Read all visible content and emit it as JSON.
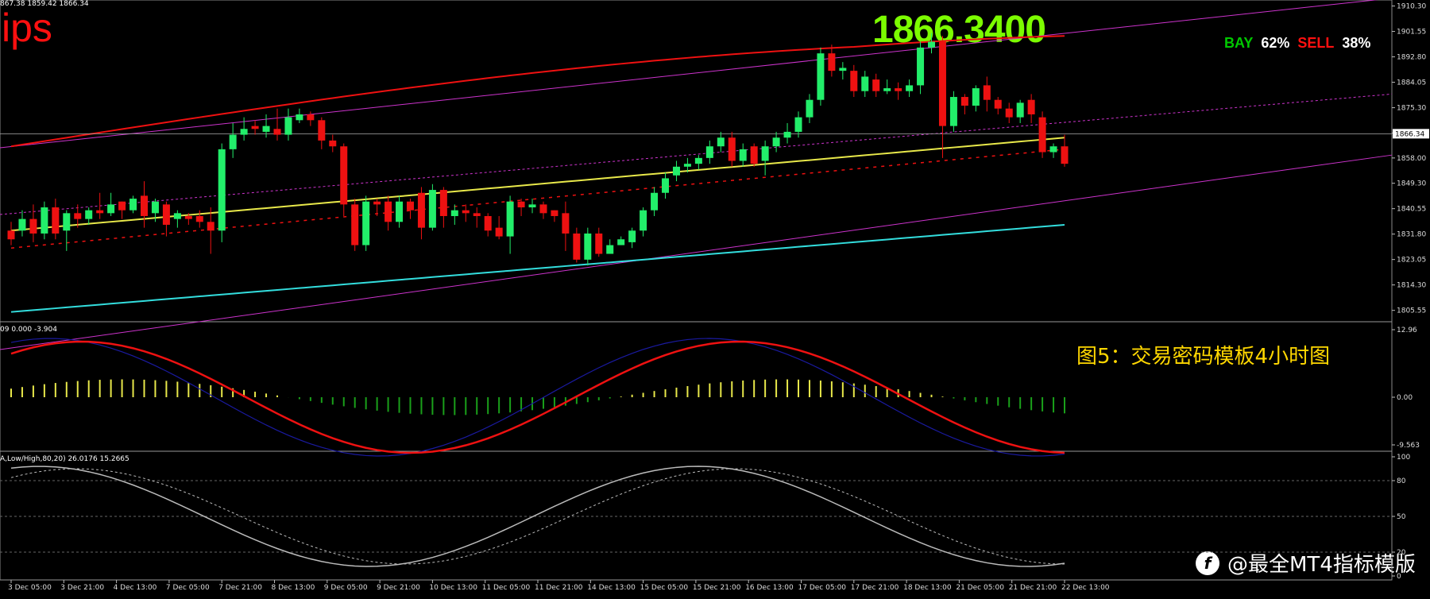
{
  "top_info": "867.38 1859.42 1866.34",
  "brand": "ips",
  "big_price": "1866.3400",
  "sentiment": {
    "buy_label": "BAY",
    "buy_pct": "62%",
    "sell_label": "SELL",
    "sell_pct": "38%"
  },
  "caption": "图5：交易密码模板4小时图",
  "macd_info": "09 0.000 -3.904",
  "stoch_info": "A,Low/High,80,20) 26.0176 15.2665",
  "watermark": "@最全MT4指标模版",
  "current_price_label": "1866.34",
  "colors": {
    "up": "#22ee6a",
    "down": "#ee1111",
    "ma_yellow": "#e8e84a",
    "ma_cyan": "#33dddd",
    "channel": "#cc33cc",
    "ma_red": "#ee1111",
    "macd_signal": "#ee1111",
    "macd_main": "#1a1aa0"
  },
  "chart_data": [
    {
      "type": "candlestick",
      "name": "price",
      "x_labels": [
        "3 Dec 05:00",
        "3 Dec 21:00",
        "4 Dec 13:00",
        "7 Dec 05:00",
        "7 Dec 21:00",
        "8 Dec 13:00",
        "9 Dec 05:00",
        "9 Dec 21:00",
        "10 Dec 13:00",
        "11 Dec 05:00",
        "11 Dec 21:00",
        "14 Dec 13:00",
        "15 Dec 05:00",
        "15 Dec 21:00",
        "16 Dec 13:00",
        "17 Dec 05:00",
        "17 Dec 21:00",
        "18 Dec 13:00",
        "21 Dec 05:00",
        "21 Dec 21:00",
        "22 Dec 13:00"
      ],
      "y_ticks": [
        1910.3,
        1901.55,
        1892.8,
        1884.05,
        1875.3,
        1866.55,
        1858.0,
        1849.3,
        1840.55,
        1831.8,
        1823.05,
        1814.3,
        1805.55
      ],
      "current_price": 1866.34,
      "candles": [
        [
          1833,
          1830,
          1836,
          1828
        ],
        [
          1833,
          1837,
          1840,
          1831
        ],
        [
          1837,
          1832,
          1842,
          1829
        ],
        [
          1832,
          1841,
          1843,
          1830
        ],
        [
          1841,
          1832,
          1844,
          1830
        ],
        [
          1833,
          1839,
          1840,
          1826
        ],
        [
          1839,
          1837,
          1842,
          1834
        ],
        [
          1837,
          1840,
          1841,
          1835
        ],
        [
          1840,
          1839,
          1846,
          1837
        ],
        [
          1839,
          1842,
          1846,
          1838
        ],
        [
          1843,
          1840,
          1843,
          1837
        ],
        [
          1840,
          1844,
          1845,
          1839
        ],
        [
          1845,
          1838,
          1850,
          1834
        ],
        [
          1839,
          1843,
          1844,
          1836
        ],
        [
          1842,
          1835,
          1843,
          1831
        ],
        [
          1837,
          1839,
          1840,
          1834
        ],
        [
          1838,
          1837,
          1839,
          1835
        ],
        [
          1838,
          1836,
          1840,
          1834
        ],
        [
          1836,
          1833,
          1841,
          1825
        ],
        [
          1833,
          1861,
          1863,
          1829
        ],
        [
          1861,
          1866,
          1870,
          1858
        ],
        [
          1866,
          1868,
          1872,
          1864
        ],
        [
          1869,
          1868,
          1871,
          1866
        ],
        [
          1867,
          1869,
          1873,
          1865
        ],
        [
          1868,
          1866,
          1875,
          1864
        ],
        [
          1866,
          1872,
          1875,
          1864
        ],
        [
          1871,
          1873,
          1875,
          1870
        ],
        [
          1873,
          1871,
          1874,
          1869
        ],
        [
          1871,
          1864,
          1872,
          1861
        ],
        [
          1864,
          1862,
          1866,
          1860
        ],
        [
          1862,
          1842,
          1863,
          1838
        ],
        [
          1842,
          1828,
          1844,
          1826
        ],
        [
          1828,
          1843,
          1845,
          1826
        ],
        [
          1843,
          1842,
          1844,
          1838
        ],
        [
          1843,
          1836,
          1845,
          1833
        ],
        [
          1836,
          1843,
          1845,
          1834
        ],
        [
          1843,
          1840,
          1844,
          1837
        ],
        [
          1846,
          1834,
          1848,
          1830
        ],
        [
          1834,
          1847,
          1849,
          1833
        ],
        [
          1847,
          1838,
          1848,
          1834
        ],
        [
          1838,
          1840,
          1842,
          1835
        ],
        [
          1840,
          1839,
          1842,
          1836
        ],
        [
          1839,
          1838,
          1841,
          1834
        ],
        [
          1838,
          1833,
          1839,
          1831
        ],
        [
          1834,
          1831,
          1838,
          1830
        ],
        [
          1831,
          1843,
          1845,
          1825
        ],
        [
          1843,
          1841,
          1844,
          1838
        ],
        [
          1841,
          1842,
          1844,
          1839
        ],
        [
          1842,
          1839,
          1843,
          1837
        ],
        [
          1840,
          1838,
          1840,
          1836
        ],
        [
          1839,
          1832,
          1843,
          1826
        ],
        [
          1832,
          1823,
          1834,
          1822
        ],
        [
          1823,
          1832,
          1834,
          1821
        ],
        [
          1832,
          1825,
          1834,
          1824
        ],
        [
          1825,
          1828,
          1830,
          1826
        ],
        [
          1828,
          1830,
          1831,
          1828
        ],
        [
          1829,
          1833,
          1834,
          1827
        ],
        [
          1833,
          1840,
          1841,
          1831
        ],
        [
          1840,
          1846,
          1848,
          1838
        ],
        [
          1846,
          1851,
          1853,
          1844
        ],
        [
          1852,
          1855,
          1857,
          1850
        ],
        [
          1855,
          1856,
          1858,
          1853
        ],
        [
          1856,
          1858,
          1859,
          1854
        ],
        [
          1858,
          1862,
          1864,
          1856
        ],
        [
          1862,
          1865,
          1867,
          1860
        ],
        [
          1865,
          1857,
          1867,
          1855
        ],
        [
          1857,
          1861,
          1863,
          1855
        ],
        [
          1862,
          1856,
          1863,
          1855
        ],
        [
          1857,
          1862,
          1864,
          1852
        ],
        [
          1862,
          1865,
          1867,
          1860
        ],
        [
          1865,
          1867,
          1870,
          1863
        ],
        [
          1867,
          1872,
          1874,
          1865
        ],
        [
          1872,
          1878,
          1880,
          1870
        ],
        [
          1878,
          1894,
          1896,
          1876
        ],
        [
          1894,
          1888,
          1897,
          1886
        ],
        [
          1888,
          1889,
          1891,
          1885
        ],
        [
          1888,
          1881,
          1890,
          1879
        ],
        [
          1881,
          1886,
          1888,
          1879
        ],
        [
          1885,
          1881,
          1887,
          1879
        ],
        [
          1881,
          1882,
          1885,
          1880
        ],
        [
          1882,
          1881,
          1884,
          1878
        ],
        [
          1881,
          1883,
          1885,
          1879
        ],
        [
          1883,
          1896,
          1898,
          1880
        ],
        [
          1896,
          1898,
          1901,
          1894
        ],
        [
          1898,
          1869,
          1900,
          1858
        ],
        [
          1869,
          1879,
          1881,
          1867
        ],
        [
          1879,
          1876,
          1880,
          1873
        ],
        [
          1876,
          1882,
          1883,
          1874
        ],
        [
          1883,
          1878,
          1886,
          1874
        ],
        [
          1878,
          1875,
          1879,
          1873
        ],
        [
          1875,
          1872,
          1877,
          1870
        ],
        [
          1872,
          1877,
          1878,
          1870
        ],
        [
          1878,
          1873,
          1880,
          1870
        ],
        [
          1872,
          1860,
          1874,
          1858
        ],
        [
          1860,
          1862,
          1863,
          1858
        ],
        [
          1862,
          1856,
          1866,
          1855
        ]
      ]
    },
    {
      "type": "line",
      "name": "macd",
      "y_ticks": [
        "12.96",
        "0.00",
        "-9.563"
      ]
    },
    {
      "type": "line",
      "name": "stochastic",
      "y_ticks": [
        "100",
        "80",
        "50",
        "20",
        "0"
      ]
    }
  ]
}
